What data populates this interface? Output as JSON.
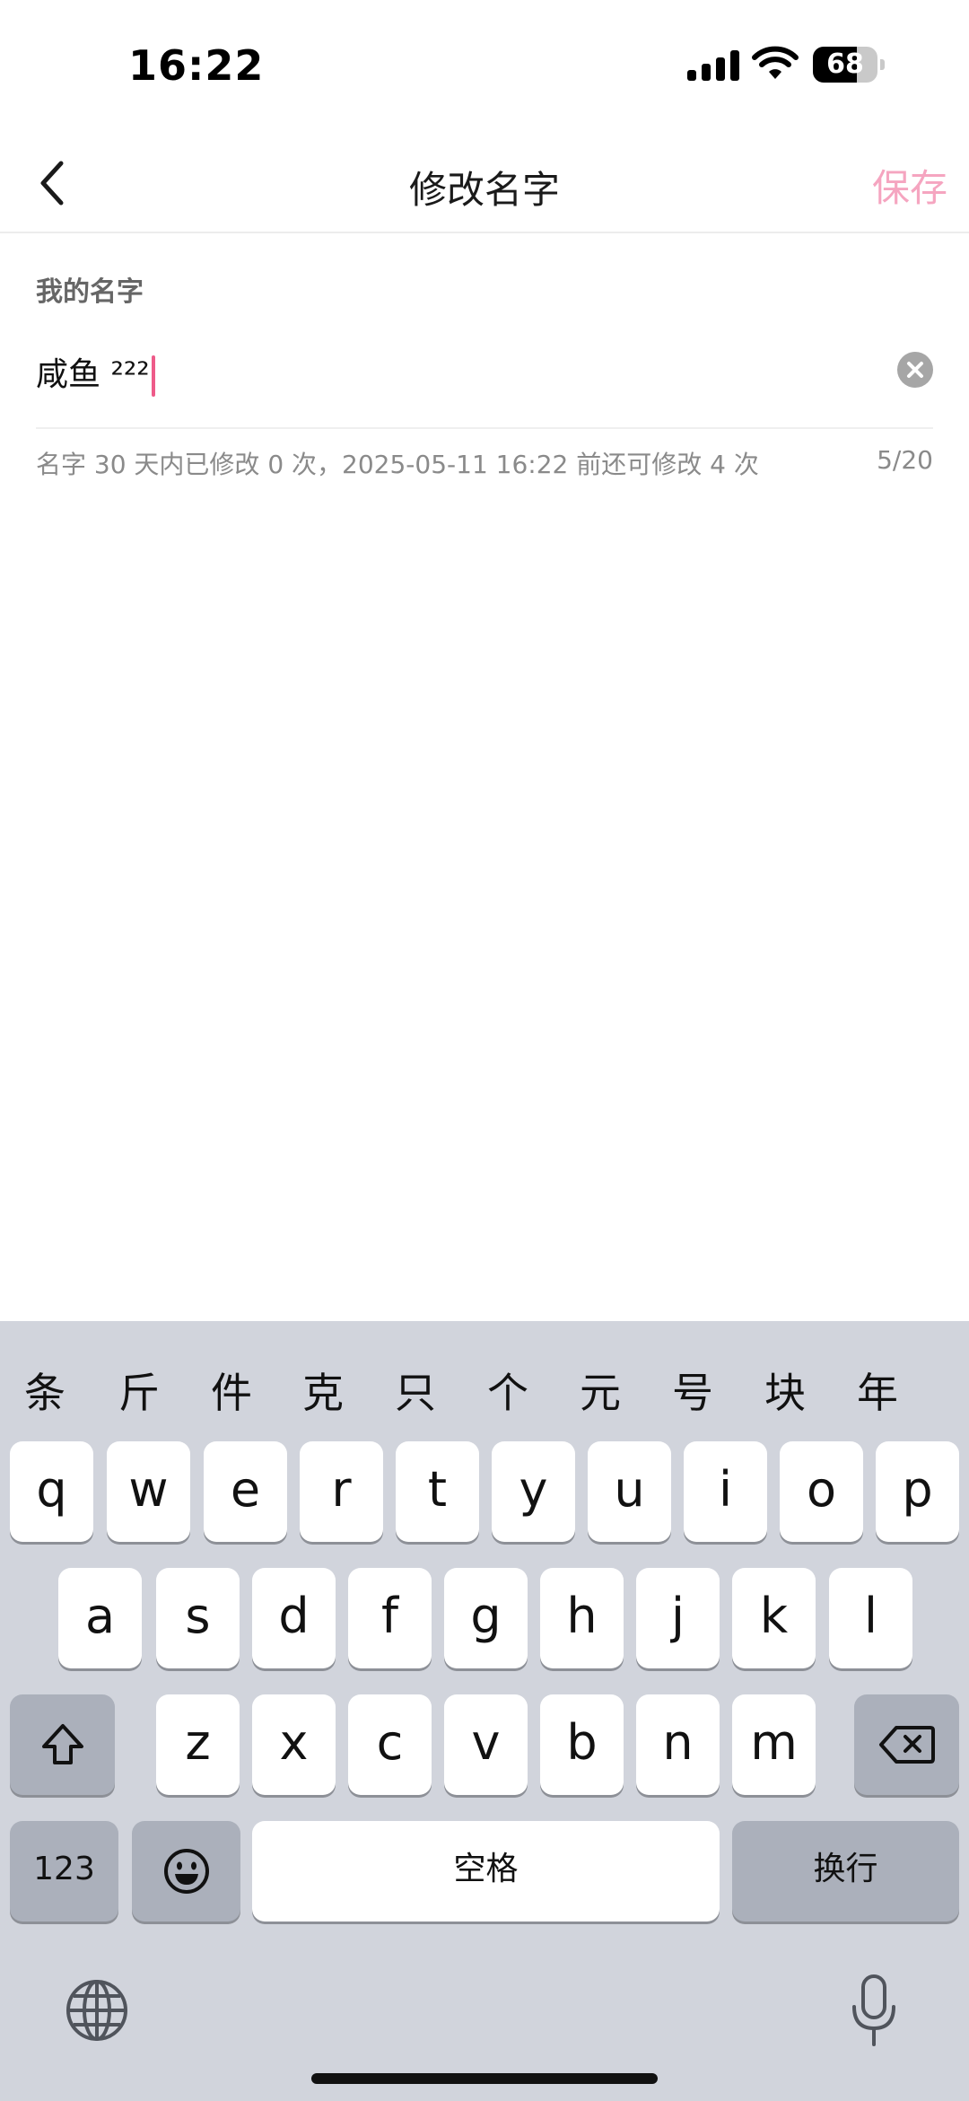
{
  "status_bar": {
    "time": "16:22",
    "battery": "68",
    "battery_level": 0.68
  },
  "nav": {
    "title": "修改名字",
    "save_label": "保存"
  },
  "form": {
    "section_label": "我的名字",
    "name_value": "咸鱼 ²²²",
    "hint": "名字 30 天内已修改 0 次，2025-05-11 16:22 前还可修改 4 次",
    "counter": "5/20"
  },
  "keyboard": {
    "candidates": [
      "条",
      "斤",
      "件",
      "克",
      "只",
      "个",
      "元",
      "号",
      "块",
      "年"
    ],
    "row1": [
      "q",
      "w",
      "e",
      "r",
      "t",
      "y",
      "u",
      "i",
      "o",
      "p"
    ],
    "row2": [
      "a",
      "s",
      "d",
      "f",
      "g",
      "h",
      "j",
      "k",
      "l"
    ],
    "row3": [
      "z",
      "x",
      "c",
      "v",
      "b",
      "n",
      "m"
    ],
    "numbers_label": "123",
    "space_label": "空格",
    "return_label": "换行"
  },
  "colors": {
    "accent": "#ee5b89",
    "save_disabled": "#f5a5c0",
    "keyboard_bg": "#d1d4dc"
  }
}
